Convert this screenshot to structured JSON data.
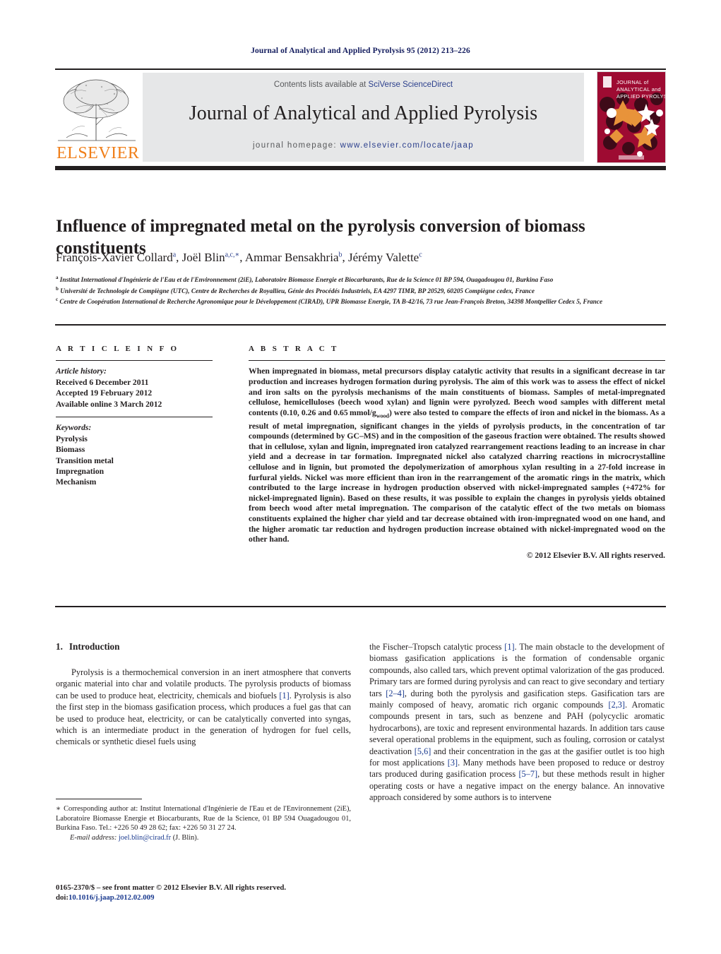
{
  "running_head": "Journal of Analytical and Applied Pyrolysis 95 (2012) 213–226",
  "masthead": {
    "contents_prefix": "Contents lists available at ",
    "contents_link": "SciVerse ScienceDirect",
    "journal_title": "Journal of Analytical and Applied Pyrolysis",
    "homepage_prefix": "journal homepage: ",
    "homepage_url": "www.elsevier.com/locate/jaap",
    "publisher_wordmark": "ELSEVIER",
    "publisher_color": "#f07f1a",
    "cover_lines": [
      "JOURNAL of",
      "ANALYTICAL and",
      "APPLIED PYROLYSIS"
    ],
    "cover_bg_color": "#9e0b32",
    "cover_accent_color": "#e8933a",
    "link_color": "#2b3f8c"
  },
  "article": {
    "title": "Influence of impregnated metal on the pyrolysis conversion of biomass constituents",
    "authors": [
      {
        "name": "François-Xavier Collard",
        "sup": "a",
        "sep": ", "
      },
      {
        "name": "Joël Blin",
        "sup": "a,c,∗",
        "sep": ", "
      },
      {
        "name": "Ammar Bensakhria",
        "sup": "b",
        "sep": ", "
      },
      {
        "name": "Jérémy Valette",
        "sup": "c",
        "sep": ""
      }
    ],
    "affiliations": [
      {
        "label": "a",
        "text": "Institut International d'Ingénierie de l'Eau et de l'Environnement (2iE), Laboratoire Biomasse Energie et Biocarburants, Rue de la Science 01 BP 594, Ouagadougou 01, Burkina Faso"
      },
      {
        "label": "b",
        "text": "Université de Technologie de Compiègne (UTC), Centre de Recherches de Royallieu, Génie des Procédés Industriels, EA 4297 TIMR, BP 20529, 60205 Compiègne cedex, France"
      },
      {
        "label": "c",
        "text": "Centre de Coopération International de Recherche Agronomique pour le Développement (CIRAD), UPR Biomasse Energie, TA B-42/16, 73 rue Jean-François Breton, 34398 Montpellier Cedex 5, France"
      }
    ]
  },
  "article_info": {
    "heading": "A R T I C L E   I N F O",
    "history_label": "Article history:",
    "history": [
      "Received 6 December 2011",
      "Accepted 19 February 2012",
      "Available online 3 March 2012"
    ],
    "keywords_label": "Keywords:",
    "keywords": [
      "Pyrolysis",
      "Biomass",
      "Transition metal",
      "Impregnation",
      "Mechanism"
    ]
  },
  "abstract": {
    "heading": "A B S T R A C T",
    "text_part1": "When impregnated in biomass, metal precursors display catalytic activity that results in a significant decrease in tar production and increases hydrogen formation during pyrolysis. The aim of this work was to assess the effect of nickel and iron salts on the pyrolysis mechanisms of the main constituents of biomass. Samples of metal-impregnated cellulose, hemicelluloses (beech wood xylan) and lignin were pyrolyzed. Beech wood samples with different metal contents (0.10, 0.26 and 0.65 mmol/g",
    "subscript": "wood",
    "text_part2": ") were also tested to compare the effects of iron and nickel in the biomass. As a result of metal impregnation, significant changes in the yields of pyrolysis products, in the concentration of tar compounds (determined by GC–MS) and in the composition of the gaseous fraction were obtained. The results showed that in cellulose, xylan and lignin, impregnated iron catalyzed rearrangement reactions leading to an increase in char yield and a decrease in tar formation. Impregnated nickel also catalyzed charring reactions in microcrystalline cellulose and in lignin, but promoted the depolymerization of amorphous xylan resulting in a 27-fold increase in furfural yields. Nickel was more efficient than iron in the rearrangement of the aromatic rings in the matrix, which contributed to the large increase in hydrogen production observed with nickel-impregnated samples (+472% for nickel-impregnated lignin). Based on these results, it was possible to explain the changes in pyrolysis yields obtained from beech wood after metal impregnation. The comparison of the catalytic effect of the two metals on biomass constituents explained the higher char yield and tar decrease obtained with iron-impregnated wood on one hand, and the higher aromatic tar reduction and hydrogen production increase obtained with nickel-impregnated wood on the other hand.",
    "copyright": "© 2012 Elsevier B.V. All rights reserved."
  },
  "body": {
    "section_number": "1.",
    "section_title": "Introduction",
    "left_column": {
      "p1_a": "Pyrolysis is a thermochemical conversion in an inert atmosphere that converts organic material into char and volatile products. The pyrolysis products of biomass can be used to produce heat, electricity, chemicals and biofuels ",
      "p1_ref1": "[1]",
      "p1_b": ". Pyrolysis is also the first step in the biomass gasification process, which produces a fuel gas that can be used to produce heat, electricity, or can be catalytically converted into syngas, which is an intermediate product in the generation of hydrogen for fuel cells, chemicals or synthetic diesel fuels using"
    },
    "right_column": {
      "r_a": "the Fischer–Tropsch catalytic process ",
      "r_ref1": "[1]",
      "r_b": ". The main obstacle to the development of biomass gasification applications is the formation of condensable organic compounds, also called tars, which prevent optimal valorization of the gas produced. Primary tars are formed during pyrolysis and can react to give secondary and tertiary tars ",
      "r_ref2": "[2–4]",
      "r_c": ", during both the pyrolysis and gasification steps. Gasification tars are mainly composed of heavy, aromatic rich organic compounds ",
      "r_ref3": "[2,3]",
      "r_d": ". Aromatic compounds present in tars, such as benzene and PAH (polycyclic aromatic hydrocarbons), are toxic and represent environmental hazards. In addition tars cause several operational problems in the equipment, such as fouling, corrosion or catalyst deactivation ",
      "r_ref4": "[5,6]",
      "r_e": " and their concentration in the gas at the gasifier outlet is too high for most applications ",
      "r_ref5": "[3]",
      "r_f": ". Many methods have been proposed to reduce or destroy tars produced during gasification process ",
      "r_ref6": "[5–7]",
      "r_g": ", but these methods result in higher operating costs or have a negative impact on the energy balance. An innovative approach considered by some authors is to intervene"
    }
  },
  "footnotes": {
    "star": "∗",
    "corresponding": "Corresponding author at: Institut International d'Ingénierie de l'Eau et de l'Environnement (2iE), Laboratoire Biomasse Energie et Biocarburants, Rue de la Science, 01 BP 594 Ouagadougou 01, Burkina Faso. Tel.: +226 50 49 28 62; fax: +226 50 31 27 24.",
    "email_label": "E-mail address:",
    "email": "joel.blin@cirad.fr",
    "email_owner": "(J. Blin).",
    "issn_line": "0165-2370/$ – see front matter © 2012 Elsevier B.V. All rights reserved.",
    "doi_label": "doi:",
    "doi": "10.1016/j.jaap.2012.02.009"
  }
}
